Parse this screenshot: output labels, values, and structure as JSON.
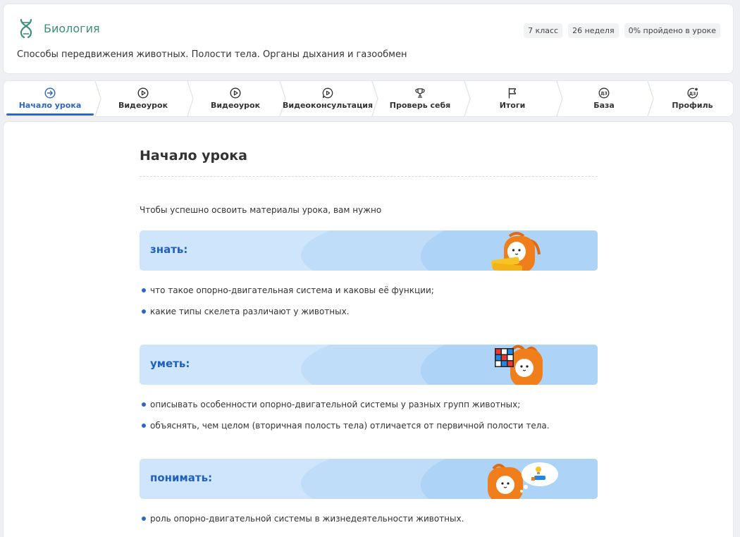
{
  "header": {
    "subject": "Биология",
    "badges": [
      "7 класс",
      "26 неделя",
      "0% пройдено в уроке"
    ],
    "lesson_title": "Способы передвижения животных. Полости тела. Органы дыхания и газообмен"
  },
  "tabs": [
    {
      "label": "Начало урока",
      "icon": "arrow-right-circle-icon",
      "active": true
    },
    {
      "label": "Видеоурок",
      "icon": "play-circle-icon"
    },
    {
      "label": "Видеоурок",
      "icon": "play-circle-icon"
    },
    {
      "label": "Видеоконсультация",
      "icon": "chat-play-icon"
    },
    {
      "label": "Проверь себя",
      "icon": "trophy-icon"
    },
    {
      "label": "Итоги",
      "icon": "flag-icon"
    },
    {
      "label": "База",
      "icon": "dz-icon"
    },
    {
      "label": "Профиль",
      "icon": "dz-star-icon"
    }
  ],
  "main": {
    "title": "Начало урока",
    "intro": "Чтобы успешно освоить материалы урока, вам нужно",
    "sections": [
      {
        "label": "знать:",
        "items": [
          "что такое опорно-двигательная система и каковы её функции;",
          "какие типы скелета различают у животных."
        ]
      },
      {
        "label": "уметь:",
        "items": [
          "описывать особенности опорно-двигательной системы у разных групп животных;",
          "объяснять, чем целом (вторичная полость тела) отличается от первичной полости тела."
        ]
      },
      {
        "label": "понимать:",
        "items": [
          "роль опорно-двигательной системы в жизнедеятельности животных."
        ]
      }
    ]
  },
  "colors": {
    "accent": "#2a67c9",
    "subject": "#3b8f7b",
    "banner": "#cfe5fb",
    "mascot": "#f07e1b"
  }
}
